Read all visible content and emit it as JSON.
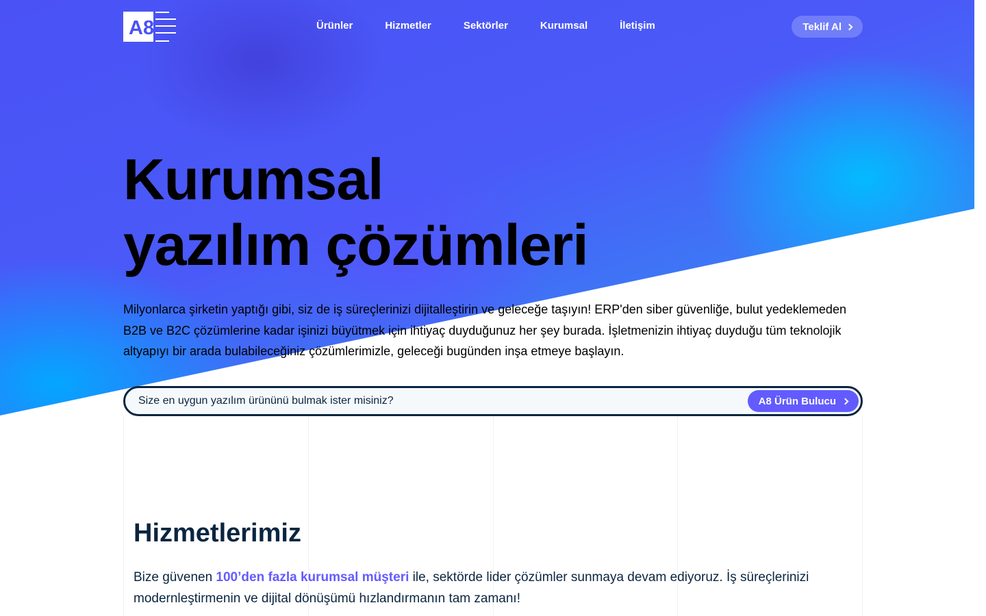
{
  "colors": {
    "accent": "#635bff",
    "text_dark": "#0a2540",
    "hero_blue": "#4a52f5",
    "hero_cyan": "#10aef5"
  },
  "header": {
    "logo_text": "A8",
    "nav": [
      {
        "label": "Ürünler"
      },
      {
        "label": "Hizmetler"
      },
      {
        "label": "Sektörler"
      },
      {
        "label": "Kurumsal"
      },
      {
        "label": "İletişim"
      }
    ],
    "cta_label": "Teklif Al",
    "cta_icon": "chevron-right-icon"
  },
  "hero": {
    "title_line1": "Kurumsal",
    "title_line2": "yazılım çözümleri",
    "description": "Milyonlarca şirketin yaptığı gibi, siz de iş süreçlerinizi dijitalleştirin ve geleceğe taşıyın! ERP'den siber güvenliğe, bulut yedeklemeden B2B ve B2C çözümlerine kadar işinizi büyütmek için ihtiyaç duyduğunuz her şey burada. İşletmenizin ihtiyaç duyduğu tüm teknolojik altyapıyı bir arada bulabileceğiniz çözümlerimizle, geleceği bugünden inşa etmeye başlayın."
  },
  "search": {
    "placeholder": "Size en uygun yazılım ürününü bulmak ister misiniz?",
    "value": "",
    "button_label": "A8 Ürün Bulucu",
    "button_icon": "chevron-right-icon"
  },
  "services": {
    "title": "Hizmetlerimiz",
    "desc_before": "Bize güvenen ",
    "desc_highlight": "100’den fazla kurumsal müşteri",
    "desc_after": " ile, sektörde lider çözümler sunmaya devam ediyoruz. İş süreçlerinizi modernleştirmenin ve dijital dönüşümü hızlandırmanın tam zamanı!"
  }
}
